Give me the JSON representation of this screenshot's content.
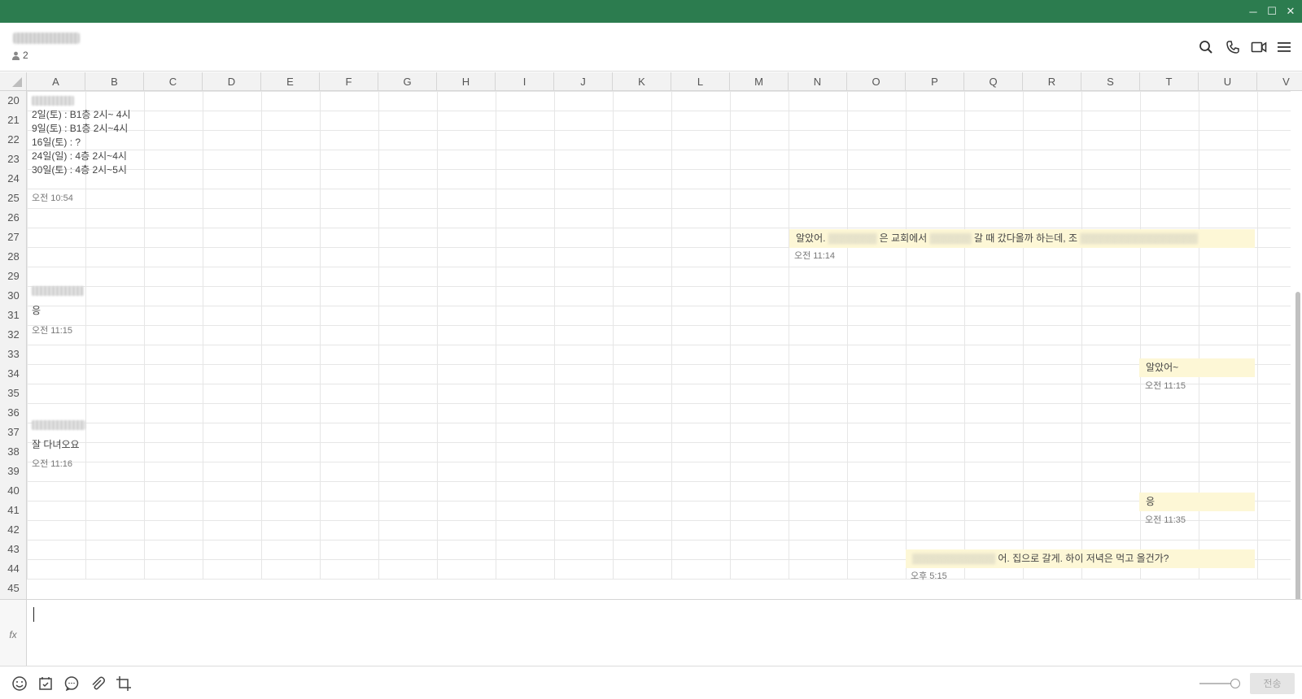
{
  "window": {
    "title_bar_color": "#2c7c4f",
    "controls": [
      "minimize",
      "maximize",
      "close"
    ],
    "control_glyphs": {
      "minimize": "─",
      "maximize": "☐",
      "close": "✕"
    }
  },
  "header": {
    "room_title": "▓▓▓▓▓▓▓▓",
    "member_count": "2",
    "icons": [
      "search-icon",
      "phone-icon",
      "video-icon",
      "menu-icon"
    ]
  },
  "sheet": {
    "columns": [
      "A",
      "B",
      "C",
      "D",
      "E",
      "F",
      "G",
      "H",
      "I",
      "J",
      "K",
      "L",
      "M",
      "N",
      "O",
      "P",
      "Q",
      "R",
      "S",
      "T",
      "U",
      "V"
    ],
    "rows": [
      "20",
      "21",
      "22",
      "23",
      "24",
      "25",
      "26",
      "27",
      "28",
      "29",
      "30",
      "31",
      "32",
      "33",
      "34",
      "35",
      "36",
      "37",
      "38",
      "39",
      "40",
      "41",
      "42",
      "43",
      "44",
      "45"
    ]
  },
  "messages": {
    "m1": {
      "sender": "▓▓▓▓▓▓",
      "lines": [
        "2일(토) : B1층 2시~ 4시",
        "9일(토) : B1층 2시~4시",
        "16일(토) : ?",
        "24일(일) : 4층 2시~4시",
        "30일(토) : 4층 2시~5시"
      ],
      "time": "오전 10:54"
    },
    "m2": {
      "text_visible_a": "알았어.",
      "text_visible_b": "은 교회에서",
      "text_visible_c": "갈 때 갔다올까 하는데, 조",
      "time": "오전 11:14"
    },
    "m3": {
      "sender": "▓▓▓▓▓▓",
      "text": "응",
      "time": "오전 11:15"
    },
    "m4": {
      "text": "알았어~",
      "time": "오전 11:15"
    },
    "m5": {
      "sender": "▓▓▓▓▓▓",
      "text": "잘 다녀오요",
      "time": "오전 11:16"
    },
    "m6": {
      "text": "응",
      "time": "오전 11:35"
    },
    "m7": {
      "text_visible": "어. 집으로 갈게. 하이 저녁은 먹고 올건가?",
      "time": "오후 5:15"
    }
  },
  "formula_bar": {
    "fx_label": "fx",
    "value": ""
  },
  "toolbar": {
    "icons": [
      "emoji-icon",
      "calendar-check-icon",
      "chat-bubble-icon",
      "attachment-icon",
      "crop-icon"
    ],
    "send_label": "전송"
  }
}
